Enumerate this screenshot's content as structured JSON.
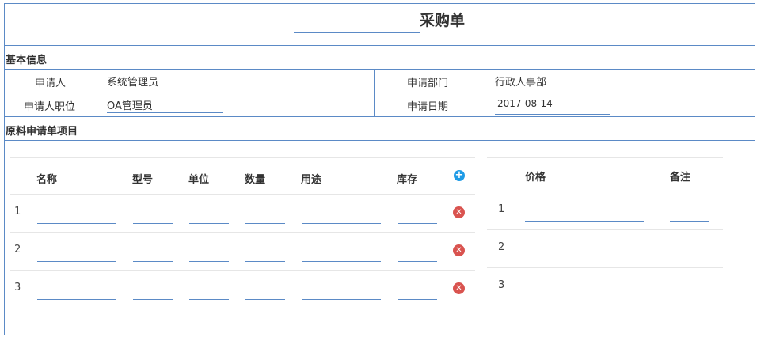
{
  "title": "采购单",
  "basic_info": {
    "section_label": "基本信息",
    "fields": [
      {
        "label": "申请人",
        "value": "系统管理员"
      },
      {
        "label": "申请部门",
        "value": "行政人事部"
      },
      {
        "label": "申请人职位",
        "value": "OA管理员"
      },
      {
        "label": "申请日期",
        "value": "2017-08-14"
      }
    ]
  },
  "items": {
    "section_label": "原料申请单项目",
    "columns": [
      "名称",
      "型号",
      "单位",
      "数量",
      "用途",
      "库存"
    ],
    "right_columns": [
      "价格",
      "备注"
    ],
    "rows": [
      "1",
      "2",
      "3"
    ],
    "add_icon": "plus-circle-icon",
    "delete_icon": "x-circle-icon",
    "accent_color": "#5b8ac6",
    "add_color": "#1e9be6",
    "delete_color": "#d9534f"
  }
}
